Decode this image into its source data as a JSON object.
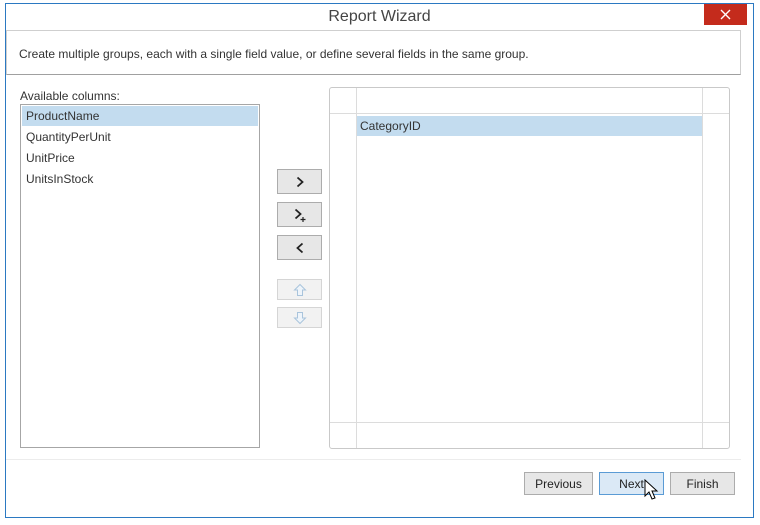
{
  "window": {
    "title": "Report Wizard"
  },
  "description": "Create multiple groups, each with a single field value, or define several fields in the same group.",
  "available": {
    "label": "Available columns:",
    "items": [
      "ProductName",
      "QuantityPerUnit",
      "UnitPrice",
      "UnitsInStock"
    ],
    "selected_index": 0
  },
  "groups": {
    "rows": [
      "CategoryID"
    ]
  },
  "icons": {
    "close": "close-icon",
    "add": "chevron-right-icon",
    "add_to_group": "chevron-right-plus-icon",
    "remove": "chevron-left-icon",
    "move_up": "arrow-up-icon",
    "move_down": "arrow-down-icon",
    "cursor": "mouse-pointer-icon"
  },
  "footer": {
    "previous": "Previous",
    "next": "Next",
    "finish": "Finish"
  },
  "colors": {
    "accent": "#2b79c2",
    "close": "#c42b1c",
    "selection": "#c3dcef"
  }
}
